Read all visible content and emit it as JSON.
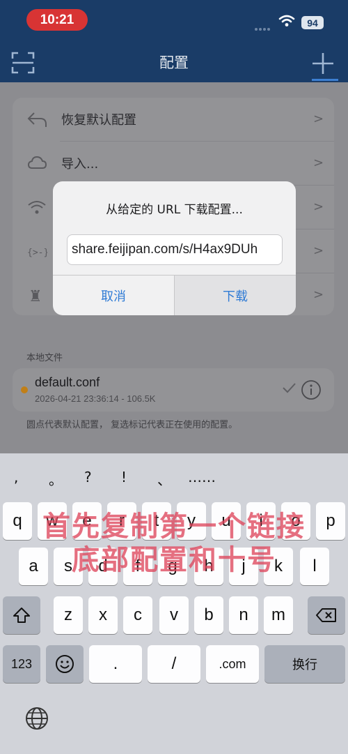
{
  "status_bar": {
    "time": "10:21",
    "battery": "94",
    "icons": [
      "signal-dots-icon",
      "wifi-icon",
      "battery-icon"
    ]
  },
  "nav": {
    "title": "配置",
    "left_icon": "scan-icon",
    "right_icon": "plus-icon"
  },
  "settings": {
    "items": [
      {
        "icon": "undo-arrow-icon",
        "label": "恢复默认配置"
      },
      {
        "icon": "cloud-icon",
        "label": "导入..."
      },
      {
        "icon": "wifi-icon",
        "label": ""
      },
      {
        "icon": "code-braces-icon",
        "label": ""
      },
      {
        "icon": "chess-icon",
        "label": ""
      }
    ]
  },
  "local_files": {
    "section_title": "本地文件",
    "file": {
      "name": "default.conf",
      "meta": "2026-04-21 23:36:14 - 106.5K",
      "default_dot_color": "#c17f17"
    },
    "footnote": "圆点代表默认配置， 复选标记代表正在使用的配置。"
  },
  "dialog": {
    "title": "从给定的 URL 下载配置...",
    "input_value": "share.feijipan.com/s/H4ax9DUh",
    "cancel_label": "取消",
    "download_label": "下载"
  },
  "keyboard": {
    "punctuation": [
      ",",
      "。",
      "?",
      "!",
      "、",
      "……"
    ],
    "row1": [
      "q",
      "w",
      "e",
      "r",
      "t",
      "y",
      "u",
      "i",
      "o",
      "p"
    ],
    "row2": [
      "a",
      "s",
      "d",
      "f",
      "g",
      "h",
      "j",
      "k",
      "l"
    ],
    "row3": [
      "z",
      "x",
      "c",
      "v",
      "b",
      "n",
      "m"
    ],
    "numbers_label": "123",
    "dot_label": ".",
    "slash_label": "/",
    "dotcom_label": ".com",
    "return_label": "换行"
  },
  "overlay": {
    "line1": "首先复制第一个链接",
    "line2": "底部配置和十号"
  }
}
